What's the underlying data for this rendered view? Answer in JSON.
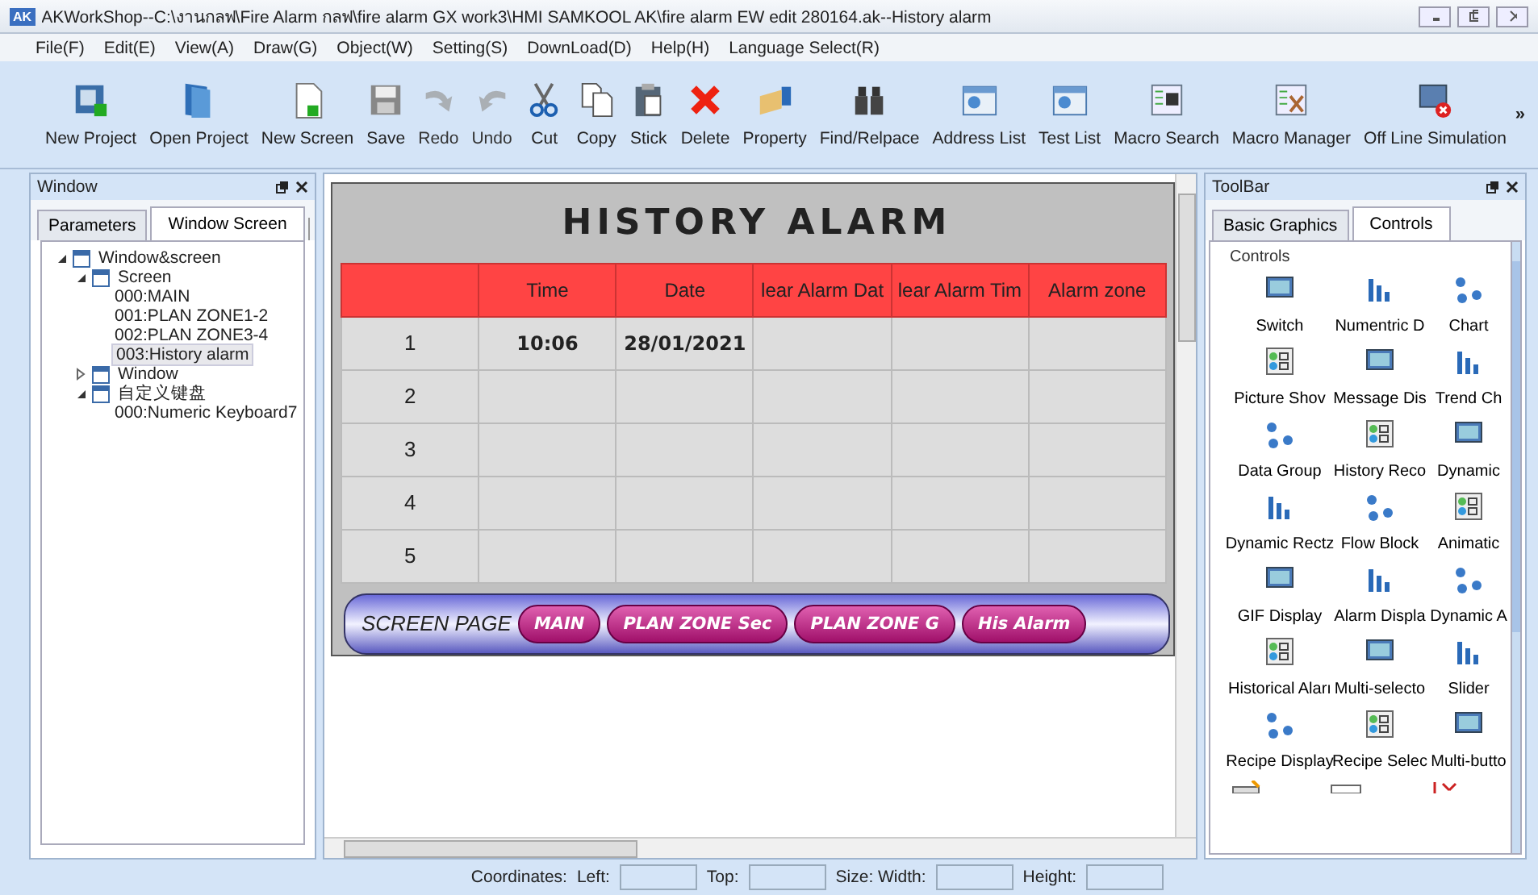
{
  "window": {
    "title": "AKWorkShop--C:\\งานกลฟ\\Fire Alarm กลฟ\\fire alarm GX work3\\HMI SAMKOOL AK\\fire alarm EW edit 280164.ak--History alarm",
    "app_badge": "AK"
  },
  "menu": [
    "File(F)",
    "Edit(E)",
    "View(A)",
    "Draw(G)",
    "Object(W)",
    "Setting(S)",
    "DownLoad(D)",
    "Help(H)",
    "Language Select(R)"
  ],
  "toolbar": [
    {
      "label": "New Project",
      "disabled": false
    },
    {
      "label": "Open Project",
      "disabled": false
    },
    {
      "label": "New Screen",
      "disabled": false
    },
    {
      "label": "Save",
      "disabled": false
    },
    {
      "label": "Redo",
      "disabled": true
    },
    {
      "label": "Undo",
      "disabled": true
    },
    {
      "label": "Cut",
      "disabled": false
    },
    {
      "label": "Copy",
      "disabled": false
    },
    {
      "label": "Stick",
      "disabled": false
    },
    {
      "label": "Delete",
      "disabled": false
    },
    {
      "label": "Property",
      "disabled": false
    },
    {
      "label": "Find/Relpace",
      "disabled": false
    },
    {
      "label": "Address List",
      "disabled": false
    },
    {
      "label": "Test List",
      "disabled": false
    },
    {
      "label": "Macro Search",
      "disabled": false
    },
    {
      "label": "Macro Manager",
      "disabled": false
    },
    {
      "label": "Off Line Simulation",
      "disabled": false
    }
  ],
  "toolbar_overflow": "»",
  "left_panel": {
    "title": "Window",
    "tabs": [
      {
        "label": "Parameters",
        "selected": false
      },
      {
        "label": "Window Screen",
        "selected": true
      }
    ],
    "tree": [
      {
        "label": "Window&screen",
        "expanded": true,
        "selected": false,
        "children": [
          {
            "label": "Screen",
            "expanded": true,
            "selected": false,
            "children": [
              {
                "label": "000:MAIN",
                "selected": false
              },
              {
                "label": "001:PLAN ZONE1-2",
                "selected": false
              },
              {
                "label": "002:PLAN ZONE3-4",
                "selected": false
              },
              {
                "label": "003:History alarm",
                "selected": true
              }
            ]
          },
          {
            "label": "Window",
            "expanded": false,
            "selected": false
          },
          {
            "label": "自定义键盘",
            "expanded": true,
            "selected": false,
            "children": [
              {
                "label": "000:Numeric Keyboard7",
                "selected": false
              }
            ]
          }
        ]
      }
    ]
  },
  "editor": {
    "title": "HISTORY ALARM",
    "table": {
      "columns": [
        "",
        "Time",
        "Date",
        "lear Alarm Dat",
        "lear Alarm Tim",
        "Alarm zone"
      ],
      "rows": [
        [
          "1",
          "10:06",
          "28/01/2021",
          "",
          "",
          ""
        ],
        [
          "2",
          "",
          "",
          "",
          "",
          ""
        ],
        [
          "3",
          "",
          "",
          "",
          "",
          ""
        ],
        [
          "4",
          "",
          "",
          "",
          "",
          ""
        ],
        [
          "5",
          "",
          "",
          "",
          "",
          ""
        ]
      ]
    },
    "nav": {
      "label": "SCREEN PAGE",
      "buttons": [
        "MAIN",
        "PLAN ZONE Sec",
        "PLAN ZONE G",
        "His Alarm"
      ]
    }
  },
  "right_panel": {
    "title": "ToolBar",
    "tabs": [
      {
        "label": "Basic Graphics",
        "selected": false
      },
      {
        "label": "Controls",
        "selected": true
      }
    ],
    "group": "Controls",
    "items": [
      "Switch",
      "Numentric D",
      "Chart",
      "Picture Shov",
      "Message Dis",
      "Trend Ch",
      "Data Group",
      "History Reco",
      "Dynamic",
      "Dynamic Rectz",
      "Flow Block",
      "Animatic",
      "GIF Display",
      "Alarm Displa",
      "Dynamic A",
      "Historical Aları",
      "Multi-selecto",
      "Slider",
      "Recipe Display",
      "Recipe Selec",
      "Multi-butto"
    ]
  },
  "status_bar": {
    "coordinates": "Coordinates:",
    "fields": [
      "Left:",
      "Top:",
      "Size:  Width:",
      "Height:"
    ]
  }
}
